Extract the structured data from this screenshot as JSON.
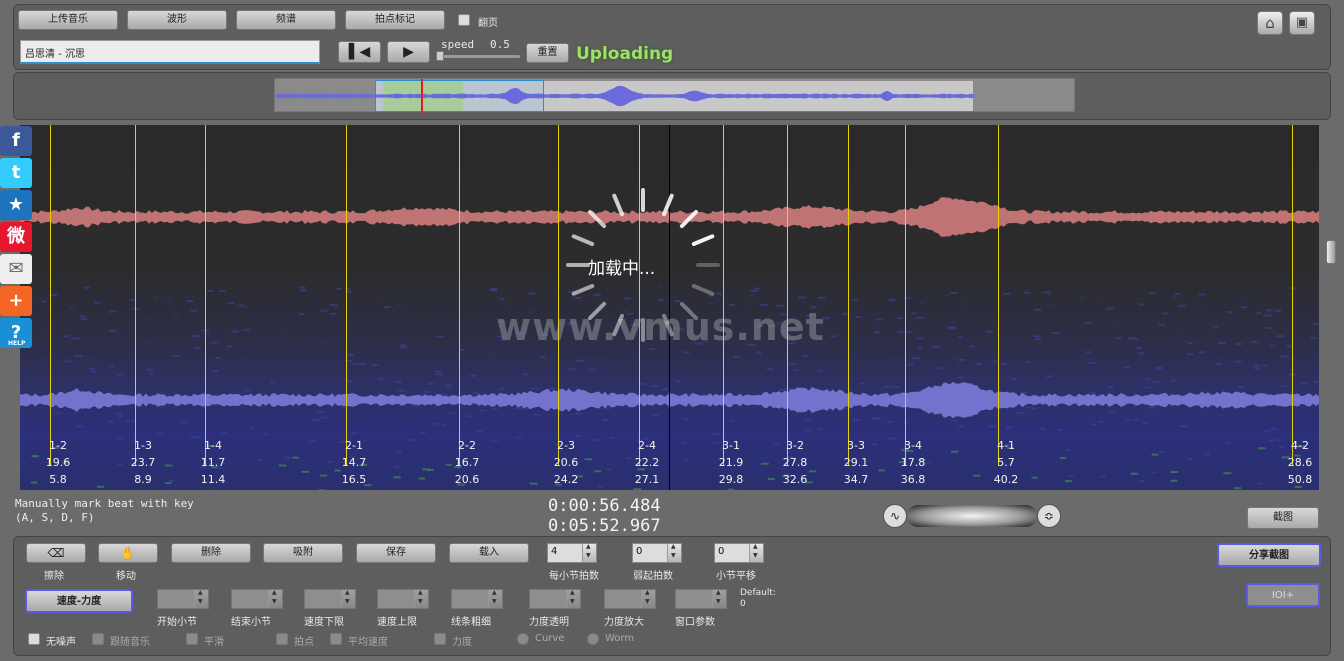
{
  "toolbar": {
    "upload_music": "上传音乐",
    "waveform": "波形",
    "spectrum": "频谱",
    "beat_mark": "拍点标记",
    "page_turn": "翻页",
    "song_title": "吕思清 - 沉思",
    "speed_label": "speed",
    "speed_value": "0.5",
    "reset": "重置",
    "status": "Uploading"
  },
  "overview": {
    "playhead_fraction": 0.06,
    "view_start_fraction": 0.0,
    "view_end_fraction": 0.21
  },
  "social": [
    {
      "name": "facebook-icon",
      "glyph": "f",
      "color": "#3b5998"
    },
    {
      "name": "twitter-icon",
      "glyph": "t",
      "color": "#33ccff"
    },
    {
      "name": "favorite-star-icon",
      "glyph": "★",
      "color": "#1e73be"
    },
    {
      "name": "weibo-icon",
      "glyph": "微",
      "color": "#e6162d"
    },
    {
      "name": "email-icon",
      "glyph": "✉",
      "color": "#eeeeee"
    },
    {
      "name": "add-share-icon",
      "glyph": "+",
      "color": "#f26522"
    },
    {
      "name": "help-icon",
      "glyph": "?",
      "color": "#1a8fd6"
    }
  ],
  "help_label": "HELP",
  "loading_text": "加载中...",
  "watermark": "www.vmus.net",
  "beats": [
    {
      "label": "1-2",
      "v1": "19.6",
      "v2": "5.8"
    },
    {
      "label": "1-3",
      "v1": "23.7",
      "v2": "8.9"
    },
    {
      "label": "1-4",
      "v1": "11.7",
      "v2": "11.4"
    },
    {
      "label": "2-1",
      "v1": "14.7",
      "v2": "16.5"
    },
    {
      "label": "2-2",
      "v1": "16.7",
      "v2": "20.6"
    },
    {
      "label": "2-3",
      "v1": "20.6",
      "v2": "24.2"
    },
    {
      "label": "2-4",
      "v1": "22.2",
      "v2": "27.1"
    },
    {
      "label": "3-1",
      "v1": "21.9",
      "v2": "29.8"
    },
    {
      "label": "3-2",
      "v1": "27.8",
      "v2": "32.6"
    },
    {
      "label": "3-3",
      "v1": "29.1",
      "v2": "34.7"
    },
    {
      "label": "3-4",
      "v1": "17.8",
      "v2": "36.8"
    },
    {
      "label": "4-1",
      "v1": "5.7",
      "v2": "40.2"
    },
    {
      "label": "4-2",
      "v1": "28.6",
      "v2": "50.8"
    }
  ],
  "hint_line1": "Manually mark beat with key",
  "hint_line2": "(A, S, D, F)",
  "time_current": "0:00:56.484",
  "time_total": "0:05:52.967",
  "screenshot_btn": "截图",
  "bottom": {
    "erase": "擦除",
    "move": "移动",
    "delete": "删除",
    "snap": "吸附",
    "save": "保存",
    "load": "载入",
    "beats_per_bar": {
      "value": "4",
      "label": "每小节拍数"
    },
    "pickup": {
      "value": "0",
      "label": "弱起拍数"
    },
    "bar_shift": {
      "value": "0",
      "label": "小节平移"
    },
    "share_screenshot": "分享截图",
    "speed_dynamics": "速度-力度",
    "params": [
      {
        "label": "开始小节"
      },
      {
        "label": "结束小节"
      },
      {
        "label": "速度下限"
      },
      {
        "label": "速度上限"
      },
      {
        "label": "线条粗细"
      },
      {
        "label": "力度透明"
      },
      {
        "label": "力度放大"
      },
      {
        "label": "窗口参数"
      }
    ],
    "default_label": "Default:",
    "default_value": "0",
    "ioi_button": "IOI+",
    "options": [
      {
        "label": "无噪声"
      },
      {
        "label": "跟随音乐"
      },
      {
        "label": "平滑"
      },
      {
        "label": "拍点"
      },
      {
        "label": "平均速度"
      },
      {
        "label": "力度"
      },
      {
        "label": "Curve"
      },
      {
        "label": "Worm"
      }
    ]
  }
}
